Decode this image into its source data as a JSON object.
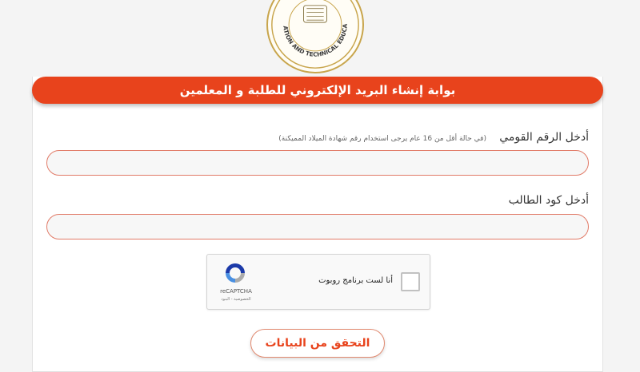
{
  "page": {
    "header_title": "بوابة إنشاء البريد الإلكتروني للطلبة و المعلمين",
    "logo_arc_text": "EDUCATION AND TECHNICAL EDUCATION"
  },
  "form": {
    "national_id_label": "أدخل الرقم القومي",
    "national_id_hint": "(في حالة أقل من 16 عام يرجى استخدام رقم شهادة الميلاد المميكنة)",
    "national_id_value": "",
    "student_code_label": "أدخل كود الطالب",
    "student_code_value": "",
    "submit_label": "التحقق من البيانات"
  },
  "captcha": {
    "checkbox_label": "أنا لست برنامج روبوت",
    "brand": "reCAPTCHA",
    "links": "الخصوصية - البنود"
  },
  "colors": {
    "accent": "#e8431c",
    "field_border": "#e17a67",
    "logo_gold": "#c8a54c"
  }
}
